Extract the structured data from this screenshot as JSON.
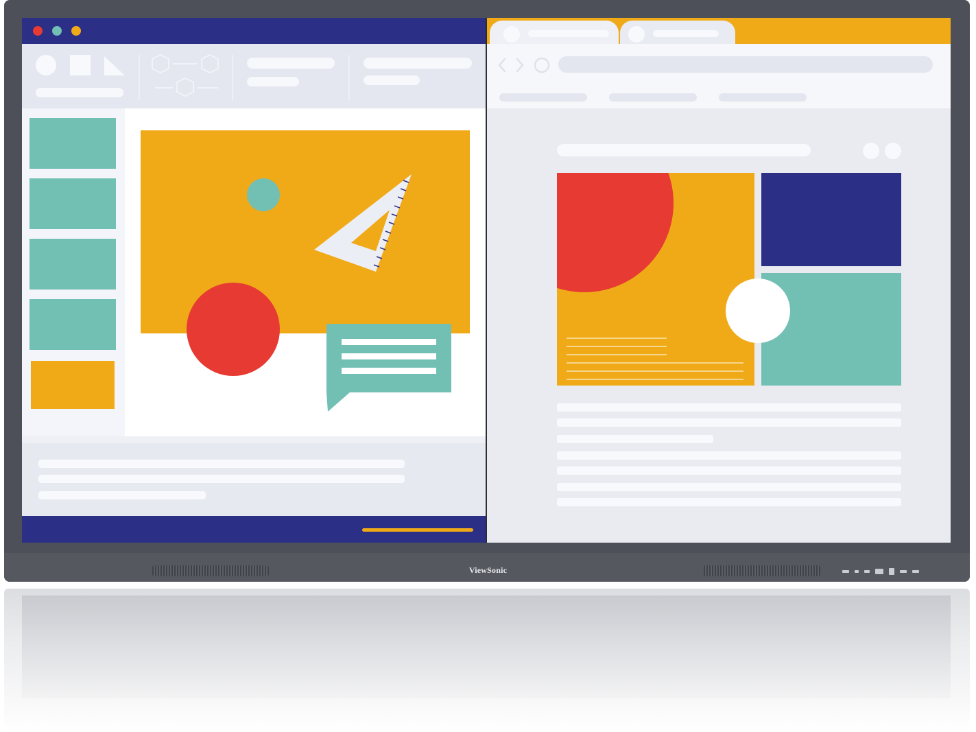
{
  "brand": "ViewSonic",
  "colors": {
    "navy": "#2b2f86",
    "amber": "#f0aa17",
    "teal": "#72bfb4",
    "red": "#e63a33",
    "bezel": "#4d5058",
    "panel": "#eef0f6"
  },
  "left_window": {
    "window_controls": [
      "close",
      "minimize",
      "maximize"
    ],
    "toolbar_tools": [
      "circle-tool",
      "square-tool",
      "triangle-tool",
      "polygon-tool"
    ],
    "sidebar_thumbnails": 5,
    "selected_thumbnail": 5
  },
  "right_window": {
    "tabs": 2,
    "nav_controls": [
      "back",
      "forward",
      "reload"
    ],
    "bookmarks": 3
  },
  "icons": [
    "circle-tool-icon",
    "square-tool-icon",
    "triangle-tool-icon",
    "hexagon-tool-icon",
    "back-icon",
    "forward-icon",
    "reload-icon",
    "set-square-icon",
    "speech-bubble-icon"
  ]
}
